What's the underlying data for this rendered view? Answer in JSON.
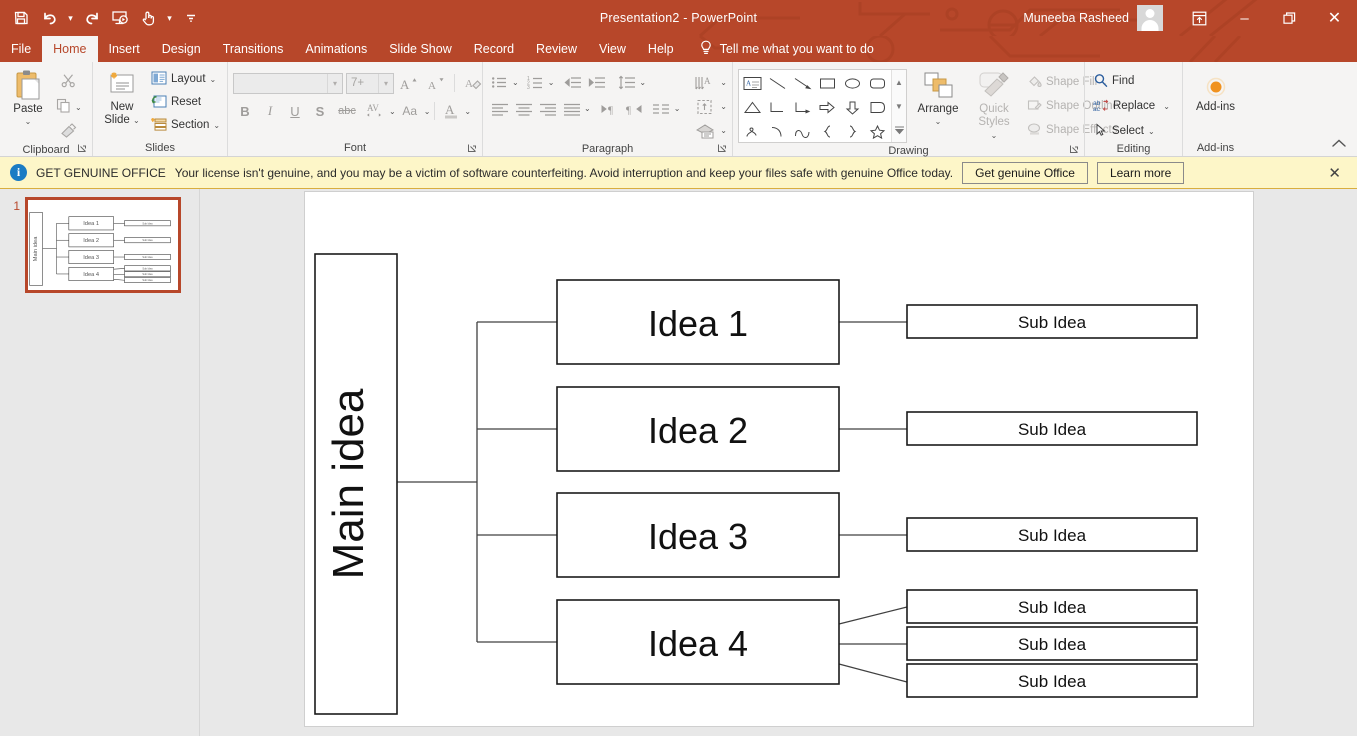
{
  "window": {
    "title": "Presentation2  -  PowerPoint",
    "user": "Muneeba Rasheed",
    "minimize": "–",
    "restore": "❐",
    "close": "✕",
    "ribbon_display_icon": "ribbon-display-options-icon",
    "accent_color": "#b7472a"
  },
  "quick_access": {
    "save": "save-icon",
    "undo": "undo-icon",
    "redo": "redo-icon",
    "start_from_beginning": "start-slideshow-icon",
    "touch_mode": "touch-mode-icon",
    "customize": "customize-qat-icon"
  },
  "tabs": [
    {
      "label": "File",
      "active": false
    },
    {
      "label": "Home",
      "active": true
    },
    {
      "label": "Insert",
      "active": false
    },
    {
      "label": "Design",
      "active": false
    },
    {
      "label": "Transitions",
      "active": false
    },
    {
      "label": "Animations",
      "active": false
    },
    {
      "label": "Slide Show",
      "active": false
    },
    {
      "label": "Record",
      "active": false
    },
    {
      "label": "Review",
      "active": false
    },
    {
      "label": "View",
      "active": false
    },
    {
      "label": "Help",
      "active": false
    }
  ],
  "tellme": {
    "label": "Tell me what you want to do",
    "icon": "lightbulb-icon"
  },
  "ribbon": {
    "clipboard": {
      "group_label": "Clipboard",
      "paste": "Paste",
      "paste_caret": "⌄",
      "cut": "cut-scissors-icon",
      "copy": "copy-icon",
      "copy_caret": "⌄",
      "format_painter": "format-painter-icon",
      "launcher": "◥"
    },
    "slides": {
      "group_label": "Slides",
      "new_slide_line1": "New",
      "new_slide_line2": "Slide",
      "new_slide_caret": "⌄",
      "layout": "Layout",
      "reset": "Reset",
      "section": "Section",
      "caret": "⌄"
    },
    "font": {
      "group_label": "Font",
      "font_name_value": "",
      "font_size_value": "7+",
      "clear_formatting": "clear-formatting-icon",
      "grow_font": "A",
      "shrink_font": "A",
      "bold": "B",
      "italic": "I",
      "underline": "U",
      "text_shadow": "S",
      "strikethrough": "abc",
      "character_spacing": "AV",
      "change_case": "Aa",
      "font_color": "A",
      "caret": "⌄",
      "launcher": "◥"
    },
    "paragraph": {
      "group_label": "Paragraph",
      "bullets": "bullets-icon",
      "numbering": "numbering-icon",
      "decrease_indent": "decrease-indent-icon",
      "increase_indent": "increase-indent-icon",
      "line_spacing": "line-spacing-icon",
      "align_left": "align-left-icon",
      "align_center": "align-center-icon",
      "align_right": "align-right-icon",
      "justify": "justify-icon",
      "columns": "columns-icon",
      "ltr": "text-direction-ltr-icon",
      "rtl": "text-direction-rtl-icon",
      "text_direction": "text-direction-icon",
      "align_text": "align-text-icon",
      "convert_smartart": "convert-to-smartart-icon",
      "caret": "⌄",
      "launcher": "◥"
    },
    "drawing": {
      "group_label": "Drawing",
      "arrange": "Arrange",
      "quick_styles_l1": "Quick",
      "quick_styles_l2": "Styles",
      "shape_fill": "Shape Fill",
      "shape_outline": "Shape Outline",
      "shape_effects": "Shape Effects",
      "caret": "⌄",
      "launcher": "◥",
      "gallery_up": "▲",
      "gallery_down": "▼",
      "gallery_more": "▼",
      "shapes": [
        "text-box-shape",
        "line-shape",
        "arrow-shape",
        "rectangle-shape",
        "oval-shape",
        "rounded-rectangle-shape",
        "triangle-shape",
        "elbow-connector-shape",
        "elbow-arrow-connector-shape",
        "right-arrow-shape",
        "down-arrow-shape",
        "pentagon-shape",
        "scribble-shape",
        "arc-shape",
        "curve-shape",
        "left-brace-shape",
        "right-brace-shape",
        "star-shape"
      ]
    },
    "editing": {
      "group_label": "Editing",
      "find": "Find",
      "replace": "Replace",
      "select": "Select",
      "caret": "⌄"
    },
    "addins": {
      "group_label": "Add-ins",
      "button_label": "Add-ins",
      "icon": "addins-dot-icon"
    },
    "collapse_ribbon": "^"
  },
  "banner": {
    "icon": "info-icon",
    "headline": "GET GENUINE OFFICE",
    "message": "Your license isn't genuine, and you may be a victim of software counterfeiting. Avoid interruption and keep your files safe with genuine Office today.",
    "primary_button": "Get genuine Office",
    "secondary_button": "Learn more",
    "close": "✕"
  },
  "thumbnails": [
    {
      "number": "1",
      "selected": true
    }
  ],
  "slide": {
    "main_idea": "Main idea",
    "ideas": [
      {
        "label": "Idea 1",
        "subs": [
          "Sub Idea"
        ]
      },
      {
        "label": "Idea 2",
        "subs": [
          "Sub Idea"
        ]
      },
      {
        "label": "Idea 3",
        "subs": [
          "Sub Idea"
        ]
      },
      {
        "label": "Idea 4",
        "subs": [
          "Sub Idea",
          "Sub Idea",
          "Sub Idea"
        ]
      }
    ]
  }
}
